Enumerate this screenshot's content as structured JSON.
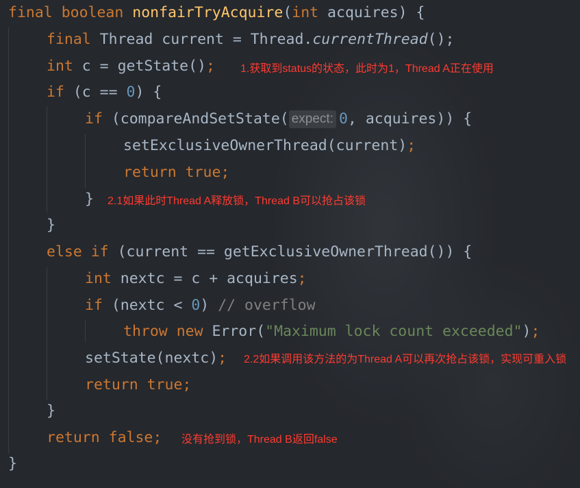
{
  "code": {
    "l1": {
      "final": "final",
      "boolean": "boolean",
      "method": "nonfairTryAcquire",
      "open": "(",
      "int": "int",
      "rest": " acquires) {"
    },
    "l2": {
      "final": "final",
      "rest": " Thread current = Thread.",
      "call": "currentThread",
      "end": "();"
    },
    "l3": {
      "int": "int",
      "rest": " c = getState()",
      "semi": ";"
    },
    "l4": {
      "if": "if",
      "a": " (c == ",
      "zero": "0",
      "b": ") {"
    },
    "l5": {
      "if": "if",
      "a": " (compareAndSetState(",
      "hint": "expect:",
      "zero": "0",
      "b": ", acquires)) {"
    },
    "l6": {
      "a": "setExclusiveOwnerThread(current)",
      "semi": ";"
    },
    "l7": {
      "return": "return",
      "true": "true",
      "semi": ";"
    },
    "l8": {
      "brace": "}"
    },
    "l9": {
      "brace": "}"
    },
    "l10": {
      "else": "else",
      "if": "if",
      "rest": " (current == getExclusiveOwnerThread()) {"
    },
    "l11": {
      "int": "int",
      "rest": " nextc = c + acquires",
      "semi": ";"
    },
    "l12": {
      "if": "if",
      "a": " (nextc < ",
      "zero": "0",
      "b": ") ",
      "comment": "// overflow"
    },
    "l13": {
      "throw": "throw",
      "new": "new",
      "a": " Error(",
      "str": "\"Maximum lock count exceeded\"",
      "b": ")",
      "semi": ";"
    },
    "l14": {
      "a": "setState(nextc)",
      "semi": ";"
    },
    "l15": {
      "return": "return",
      "true": "true",
      "semi": ";"
    },
    "l16": {
      "brace": "}"
    },
    "l17": {
      "return": "return",
      "false": "false",
      "semi": ";"
    },
    "l18": {
      "brace": "}"
    }
  },
  "annotations": {
    "a1": "1.获取到status的状态，此时为1，Thread A正在使用",
    "a2": "2.1如果此时Thread A释放锁，Thread B可以抢占该锁",
    "a3": "2.2如果调用该方法的为Thread A可以再次抢占该锁，实现可重入锁",
    "a4": "没有抢到锁，Thread B返回false"
  },
  "colors": {
    "background": "#25282d",
    "keyword": "#cc7832",
    "method": "#ffc66d",
    "number": "#6897bb",
    "string": "#6a8759",
    "comment": "#808080",
    "text": "#a9b7c6",
    "annotation": "#ff3b30"
  }
}
